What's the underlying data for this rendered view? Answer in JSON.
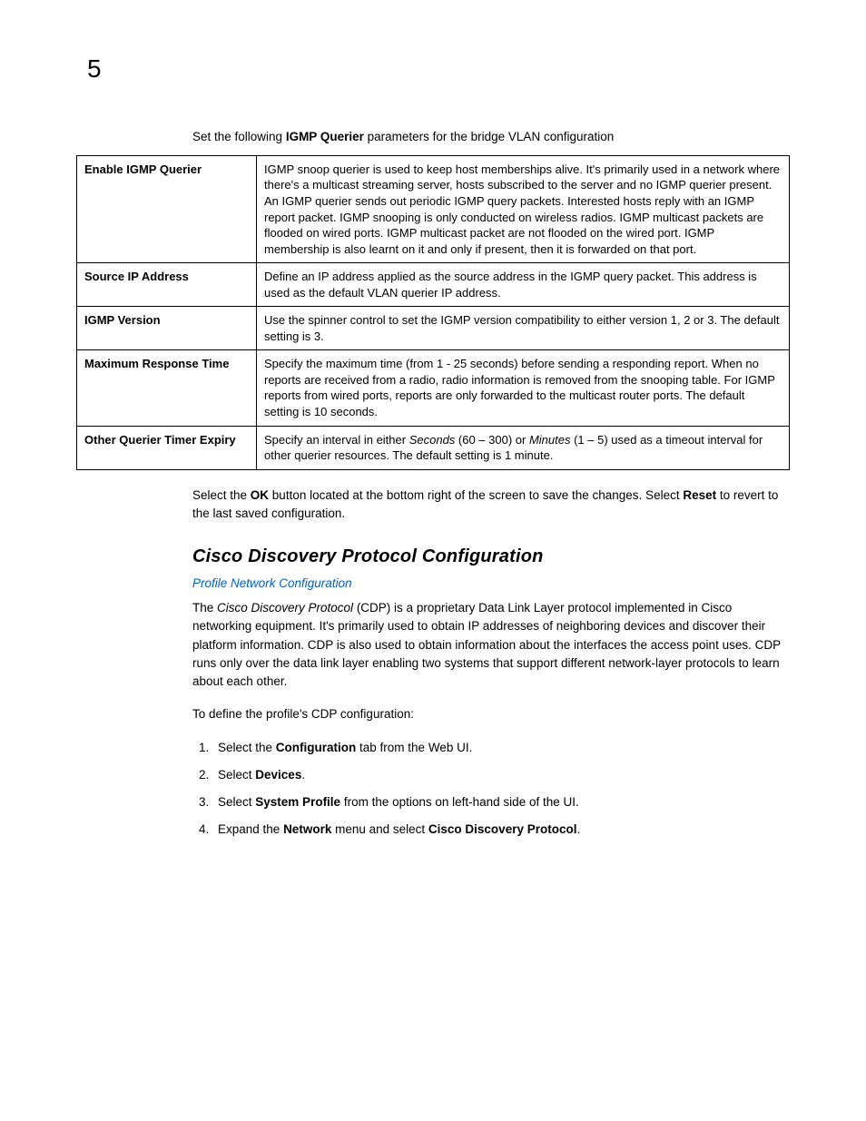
{
  "chapter": "5",
  "intro": {
    "prefix": "Set the following ",
    "bold": "IGMP Querier",
    "suffix": " parameters for the bridge VLAN configuration"
  },
  "table": {
    "rows": [
      {
        "label": "Enable IGMP Querier",
        "desc": "IGMP snoop querier is used to keep host memberships alive. It's primarily used in a network where there's a multicast streaming server, hosts subscribed to the server and no IGMP querier present. An IGMP querier sends out periodic IGMP query packets. Interested hosts reply with an IGMP report packet. IGMP snooping is only conducted on wireless radios. IGMP multicast packets are flooded on wired ports. IGMP multicast packet are not flooded on the wired port. IGMP membership is also learnt on it and only if present, then it is forwarded on that port."
      },
      {
        "label": "Source IP Address",
        "desc": "Define an IP address applied as the source address in the IGMP query packet. This address is used as the default VLAN querier IP address."
      },
      {
        "label": "IGMP Version",
        "desc": "Use the spinner control to set the IGMP version compatibility to either version 1, 2 or 3. The default setting is 3."
      },
      {
        "label": "Maximum Response Time",
        "desc": "Specify the maximum time (from 1 - 25 seconds) before sending a responding report. When no reports are received from a radio, radio information is removed from the snooping table. For IGMP reports from wired ports, reports are only forwarded to the multicast router ports. The default setting is 10 seconds."
      },
      {
        "label": "Other Querier Timer Expiry",
        "desc_pre": "Specify an interval in either ",
        "desc_i1": "Seconds",
        "desc_mid1": " (60 – 300) or ",
        "desc_i2": "Minutes",
        "desc_mid2": " (1 – 5) used as a timeout interval for other querier resources. The default setting is 1 minute."
      }
    ]
  },
  "ok_para": {
    "p1": "Select the ",
    "b1": "OK",
    "p2": " button located at the bottom right of the screen to save the changes. Select ",
    "b2": "Reset",
    "p3": " to revert to the last saved configuration."
  },
  "section_heading": "Cisco Discovery Protocol Configuration",
  "link_text": "Profile Network Configuration",
  "cdp_para": {
    "p1": "The ",
    "i1": "Cisco Discovery Protocol",
    "p2": " (CDP) is a proprietary Data Link Layer protocol implemented in Cisco networking equipment. It's primarily used to obtain IP addresses of neighboring devices and discover their platform information. CDP is also used to obtain information about the interfaces the access point uses. CDP runs only over the data link layer enabling two systems that support different network-layer protocols to learn about each other."
  },
  "define_line": "To define the profile's CDP configuration:",
  "steps": [
    {
      "pre": "Select the ",
      "b": "Configuration",
      "post": " tab from the Web UI."
    },
    {
      "pre": "Select ",
      "b": "Devices",
      "post": "."
    },
    {
      "pre": "Select ",
      "b": "System Profile",
      "post": " from the options on left-hand side of the UI."
    },
    {
      "pre": "Expand the ",
      "b": "Network",
      "mid": " menu and select ",
      "b2": "Cisco Discovery Protocol",
      "post": "."
    }
  ]
}
